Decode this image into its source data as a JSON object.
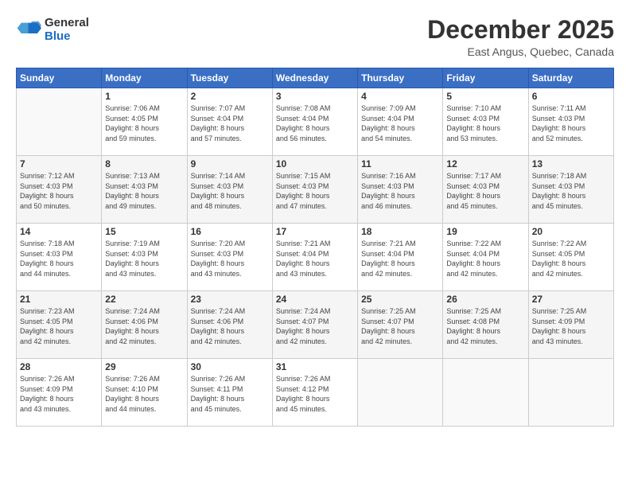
{
  "header": {
    "logo_line1": "General",
    "logo_line2": "Blue",
    "month": "December 2025",
    "location": "East Angus, Quebec, Canada"
  },
  "weekdays": [
    "Sunday",
    "Monday",
    "Tuesday",
    "Wednesday",
    "Thursday",
    "Friday",
    "Saturday"
  ],
  "weeks": [
    [
      {
        "day": "",
        "info": ""
      },
      {
        "day": "1",
        "info": "Sunrise: 7:06 AM\nSunset: 4:05 PM\nDaylight: 8 hours\nand 59 minutes."
      },
      {
        "day": "2",
        "info": "Sunrise: 7:07 AM\nSunset: 4:04 PM\nDaylight: 8 hours\nand 57 minutes."
      },
      {
        "day": "3",
        "info": "Sunrise: 7:08 AM\nSunset: 4:04 PM\nDaylight: 8 hours\nand 56 minutes."
      },
      {
        "day": "4",
        "info": "Sunrise: 7:09 AM\nSunset: 4:04 PM\nDaylight: 8 hours\nand 54 minutes."
      },
      {
        "day": "5",
        "info": "Sunrise: 7:10 AM\nSunset: 4:03 PM\nDaylight: 8 hours\nand 53 minutes."
      },
      {
        "day": "6",
        "info": "Sunrise: 7:11 AM\nSunset: 4:03 PM\nDaylight: 8 hours\nand 52 minutes."
      }
    ],
    [
      {
        "day": "7",
        "info": "Sunrise: 7:12 AM\nSunset: 4:03 PM\nDaylight: 8 hours\nand 50 minutes."
      },
      {
        "day": "8",
        "info": "Sunrise: 7:13 AM\nSunset: 4:03 PM\nDaylight: 8 hours\nand 49 minutes."
      },
      {
        "day": "9",
        "info": "Sunrise: 7:14 AM\nSunset: 4:03 PM\nDaylight: 8 hours\nand 48 minutes."
      },
      {
        "day": "10",
        "info": "Sunrise: 7:15 AM\nSunset: 4:03 PM\nDaylight: 8 hours\nand 47 minutes."
      },
      {
        "day": "11",
        "info": "Sunrise: 7:16 AM\nSunset: 4:03 PM\nDaylight: 8 hours\nand 46 minutes."
      },
      {
        "day": "12",
        "info": "Sunrise: 7:17 AM\nSunset: 4:03 PM\nDaylight: 8 hours\nand 45 minutes."
      },
      {
        "day": "13",
        "info": "Sunrise: 7:18 AM\nSunset: 4:03 PM\nDaylight: 8 hours\nand 45 minutes."
      }
    ],
    [
      {
        "day": "14",
        "info": "Sunrise: 7:18 AM\nSunset: 4:03 PM\nDaylight: 8 hours\nand 44 minutes."
      },
      {
        "day": "15",
        "info": "Sunrise: 7:19 AM\nSunset: 4:03 PM\nDaylight: 8 hours\nand 43 minutes."
      },
      {
        "day": "16",
        "info": "Sunrise: 7:20 AM\nSunset: 4:03 PM\nDaylight: 8 hours\nand 43 minutes."
      },
      {
        "day": "17",
        "info": "Sunrise: 7:21 AM\nSunset: 4:04 PM\nDaylight: 8 hours\nand 43 minutes."
      },
      {
        "day": "18",
        "info": "Sunrise: 7:21 AM\nSunset: 4:04 PM\nDaylight: 8 hours\nand 42 minutes."
      },
      {
        "day": "19",
        "info": "Sunrise: 7:22 AM\nSunset: 4:04 PM\nDaylight: 8 hours\nand 42 minutes."
      },
      {
        "day": "20",
        "info": "Sunrise: 7:22 AM\nSunset: 4:05 PM\nDaylight: 8 hours\nand 42 minutes."
      }
    ],
    [
      {
        "day": "21",
        "info": "Sunrise: 7:23 AM\nSunset: 4:05 PM\nDaylight: 8 hours\nand 42 minutes."
      },
      {
        "day": "22",
        "info": "Sunrise: 7:24 AM\nSunset: 4:06 PM\nDaylight: 8 hours\nand 42 minutes."
      },
      {
        "day": "23",
        "info": "Sunrise: 7:24 AM\nSunset: 4:06 PM\nDaylight: 8 hours\nand 42 minutes."
      },
      {
        "day": "24",
        "info": "Sunrise: 7:24 AM\nSunset: 4:07 PM\nDaylight: 8 hours\nand 42 minutes."
      },
      {
        "day": "25",
        "info": "Sunrise: 7:25 AM\nSunset: 4:07 PM\nDaylight: 8 hours\nand 42 minutes."
      },
      {
        "day": "26",
        "info": "Sunrise: 7:25 AM\nSunset: 4:08 PM\nDaylight: 8 hours\nand 42 minutes."
      },
      {
        "day": "27",
        "info": "Sunrise: 7:25 AM\nSunset: 4:09 PM\nDaylight: 8 hours\nand 43 minutes."
      }
    ],
    [
      {
        "day": "28",
        "info": "Sunrise: 7:26 AM\nSunset: 4:09 PM\nDaylight: 8 hours\nand 43 minutes."
      },
      {
        "day": "29",
        "info": "Sunrise: 7:26 AM\nSunset: 4:10 PM\nDaylight: 8 hours\nand 44 minutes."
      },
      {
        "day": "30",
        "info": "Sunrise: 7:26 AM\nSunset: 4:11 PM\nDaylight: 8 hours\nand 45 minutes."
      },
      {
        "day": "31",
        "info": "Sunrise: 7:26 AM\nSunset: 4:12 PM\nDaylight: 8 hours\nand 45 minutes."
      },
      {
        "day": "",
        "info": ""
      },
      {
        "day": "",
        "info": ""
      },
      {
        "day": "",
        "info": ""
      }
    ]
  ]
}
